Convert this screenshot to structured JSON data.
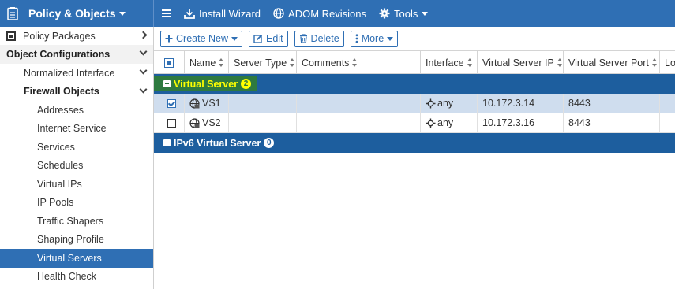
{
  "app": {
    "module_label": "Policy & Objects",
    "menu": {
      "install_wizard": "Install Wizard",
      "adom_revisions": "ADOM Revisions",
      "tools": "Tools"
    }
  },
  "sidebar": {
    "policy_packages": "Policy Packages",
    "object_configurations": "Object Configurations",
    "normalized_interface": "Normalized Interface",
    "firewall_objects": "Firewall Objects",
    "items": [
      {
        "label": "Addresses"
      },
      {
        "label": "Internet Service"
      },
      {
        "label": "Services"
      },
      {
        "label": "Schedules"
      },
      {
        "label": "Virtual IPs"
      },
      {
        "label": "IP Pools"
      },
      {
        "label": "Traffic Shapers"
      },
      {
        "label": "Shaping Profile"
      },
      {
        "label": "Virtual Servers"
      },
      {
        "label": "Health Check"
      }
    ],
    "active_item": "Virtual Servers"
  },
  "toolbar": {
    "create_new": "Create New",
    "edit": "Edit",
    "delete": "Delete",
    "more": "More"
  },
  "table": {
    "columns": [
      "Name",
      "Server Type",
      "Comments",
      "Interface",
      "Virtual Server IP",
      "Virtual Server Port",
      "Loa"
    ],
    "groups": [
      {
        "label": "Virtual Server",
        "count": "2",
        "rows": [
          {
            "name": "VS1",
            "server_type": "",
            "comments": "",
            "interface": "any",
            "vs_ip": "10.172.3.14",
            "vs_port": "8443",
            "checked": true
          },
          {
            "name": "VS2",
            "server_type": "",
            "comments": "",
            "interface": "any",
            "vs_ip": "10.172.3.16",
            "vs_port": "8443",
            "checked": false
          }
        ]
      },
      {
        "label": "IPv6 Virtual Server",
        "count": "0",
        "rows": []
      }
    ]
  },
  "colors": {
    "primary": "#2f6fb4",
    "group_header": "#1d5e9e",
    "highlight_bg": "#2e7a3f",
    "highlight_text": "#ffff00",
    "selected_row": "#cfddee"
  }
}
